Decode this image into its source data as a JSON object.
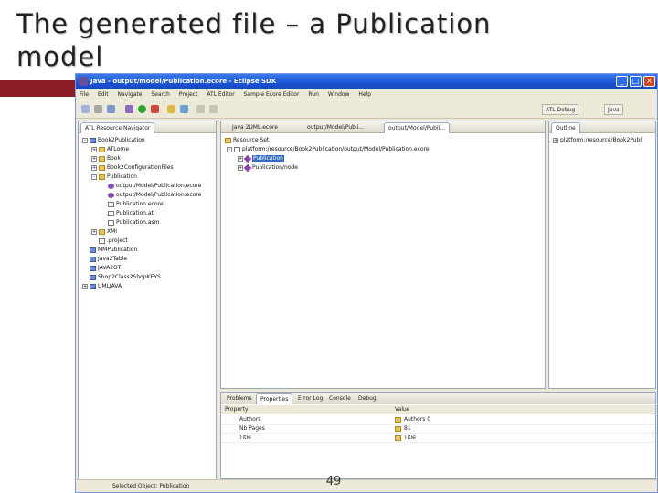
{
  "slide": {
    "title_line1": "The generated file – a Publication",
    "title_line2": "model",
    "page_number": "49"
  },
  "window": {
    "title": "Java - output/model/Publication.ecore - Eclipse SDK",
    "minimize_glyph": "_",
    "maximize_glyph": "□",
    "close_glyph": "×"
  },
  "menu": [
    "File",
    "Edit",
    "Navigate",
    "Search",
    "Project",
    "ATL Editor",
    "Sample Ecore Editor",
    "Run",
    "Window",
    "Help"
  ],
  "perspectives": [
    "ATL Debug",
    "Java"
  ],
  "navigator": {
    "tab_label": "ATL Resource Navigator",
    "items": [
      {
        "label": "Book2Publication",
        "depth": 0,
        "kind": "proj",
        "exp": "-"
      },
      {
        "label": "ATLorne",
        "depth": 1,
        "kind": "folder",
        "exp": "+"
      },
      {
        "label": "Book",
        "depth": 1,
        "kind": "folder",
        "exp": "+"
      },
      {
        "label": "Book2ConfigurationFiles",
        "depth": 1,
        "kind": "folder",
        "exp": "+"
      },
      {
        "label": "Publication",
        "depth": 1,
        "kind": "folder",
        "exp": "-"
      },
      {
        "label": "output/Model/Publication.ecore",
        "depth": 2,
        "kind": "ecore",
        "exp": ""
      },
      {
        "label": "output/Model/Publication.ecore",
        "depth": 2,
        "kind": "ecore",
        "exp": ""
      },
      {
        "label": "Publication.ecore",
        "depth": 2,
        "kind": "file",
        "exp": ""
      },
      {
        "label": "Publication.atl",
        "depth": 2,
        "kind": "file",
        "exp": ""
      },
      {
        "label": "Publication.asm",
        "depth": 2,
        "kind": "file",
        "exp": ""
      },
      {
        "label": "XMI",
        "depth": 1,
        "kind": "folder",
        "exp": "+"
      },
      {
        "label": ".project",
        "depth": 1,
        "kind": "file",
        "exp": ""
      },
      {
        "label": "MMPublication",
        "depth": 0,
        "kind": "proj",
        "exp": ""
      },
      {
        "label": "Java2Table",
        "depth": 0,
        "kind": "proj",
        "exp": ""
      },
      {
        "label": "JAVA2OT",
        "depth": 0,
        "kind": "proj",
        "exp": ""
      },
      {
        "label": "Shop2Class2ShopKEYS",
        "depth": 0,
        "kind": "proj",
        "exp": ""
      },
      {
        "label": "UMLJAVA",
        "depth": 0,
        "kind": "proj",
        "exp": "+"
      }
    ]
  },
  "editor": {
    "tabs": [
      "Java 2UML.ecore",
      "output/Model/Publi...",
      "output/Model/Publi..."
    ],
    "resource_set_label": "Resource Set",
    "tree": [
      {
        "label": "platform:/resource/Book2Publication/output/Model/Publication.ecore",
        "depth": 0
      },
      {
        "label": "Publication",
        "depth": 1,
        "selected": true
      },
      {
        "label": "Publication/node",
        "depth": 1,
        "selected": false
      }
    ]
  },
  "outline": {
    "tab_label": "Outline",
    "item": "platform:/resource/Book2Publ"
  },
  "bottom": {
    "tabs": [
      "Problems",
      "Properties",
      "Error Log",
      "Console",
      "Debug"
    ],
    "columns": [
      "Property",
      "Value"
    ],
    "rows": [
      {
        "property": "Authors",
        "value": "Authors 0"
      },
      {
        "property": "Nb Pages",
        "value": "81"
      },
      {
        "property": "Title",
        "value": "Title"
      }
    ]
  },
  "status": {
    "text": "Selected Object: Publication"
  },
  "colors": {
    "accent_bar": "#8b1c24",
    "titlebar_blue": "#1b53d6",
    "selection_blue": "#316ac5"
  }
}
